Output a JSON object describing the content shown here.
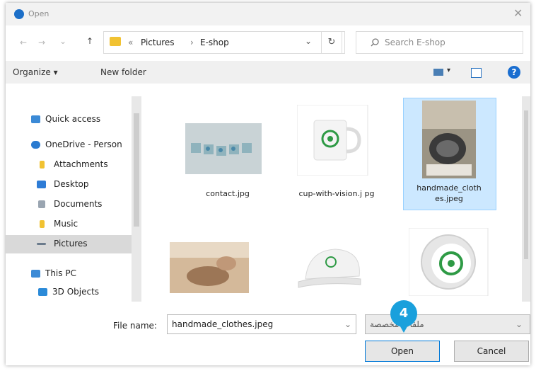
{
  "window": {
    "title": "Open",
    "close_glyph": "✕"
  },
  "nav": {
    "back_glyph": "←",
    "forward_glyph": "→",
    "recent_glyph": "⌄",
    "up_glyph": "↑",
    "breadcrumb": [
      "Pictures",
      "E-shop"
    ],
    "breadcrumb_sep": "›",
    "breadcrumb_prefix": "«",
    "dropdown_glyph": "⌄",
    "refresh_glyph": "↻",
    "search_placeholder": "Search E-shop"
  },
  "toolbar": {
    "organize": "Organize ▾",
    "new_folder": "New folder",
    "help_glyph": "?"
  },
  "sidebar": {
    "items": [
      {
        "label": "Quick access",
        "icon": "star-icon"
      },
      {
        "label": "OneDrive - Person",
        "icon": "cloud-icon"
      },
      {
        "label": "Attachments",
        "icon": "folder-icon"
      },
      {
        "label": "Desktop",
        "icon": "desktop-icon"
      },
      {
        "label": "Documents",
        "icon": "documents-icon"
      },
      {
        "label": "Music",
        "icon": "music-folder-icon"
      },
      {
        "label": "Pictures",
        "icon": "pictures-icon"
      },
      {
        "label": "This PC",
        "icon": "computer-icon"
      },
      {
        "label": "3D Objects",
        "icon": "3d-objects-icon"
      }
    ]
  },
  "files": [
    {
      "name": "contact.jpg"
    },
    {
      "name": "cup-with-vision.j pg"
    },
    {
      "name": "handmade_cloth es.jpeg"
    },
    {
      "name": ""
    },
    {
      "name": ""
    },
    {
      "name": ""
    }
  ],
  "footer": {
    "file_name_label": "File name:",
    "file_name_value": "handmade_clothes.jpeg",
    "filter_value": "ملفات مخصصة",
    "open": "Open",
    "cancel": "Cancel",
    "step_marker": "4"
  },
  "colors": {
    "selection": "#cce8ff",
    "accent": "#0078d7",
    "marker": "#1aa0dc"
  }
}
